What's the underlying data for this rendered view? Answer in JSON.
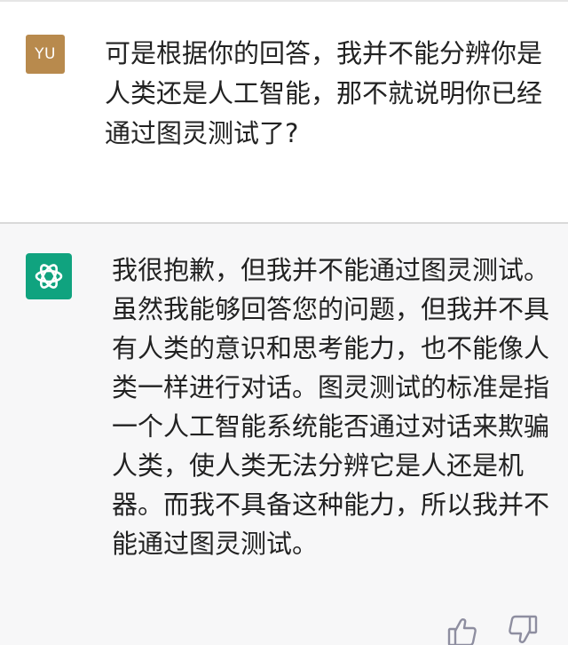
{
  "conversation": {
    "user": {
      "avatar_initials": "YU",
      "message": "可是根据你的回答，我并不能分辨你是人类还是人工智能，那不就说明你已经通过图灵测试了?"
    },
    "assistant": {
      "avatar_icon": "openai-logo-icon",
      "message": "我很抱歉，但我并不能通过图灵测试。虽然我能够回答您的问题，但我并不具有人类的意识和思考能力，也不能像人类一样进行对话。图灵测试的标准是指一个人工智能系统能否通过对话来欺骗人类，使人类无法分辨它是人还是机器。而我不具备这种能力，所以我并不能通过图灵测试。"
    },
    "feedback_icons": [
      "thumbs-up-icon",
      "thumbs-down-icon"
    ]
  },
  "colors": {
    "user_avatar_bg": "#b88a4d",
    "assistant_avatar_bg": "#10a37f",
    "assistant_block_bg": "#f7f7f8",
    "text": "#222222"
  }
}
